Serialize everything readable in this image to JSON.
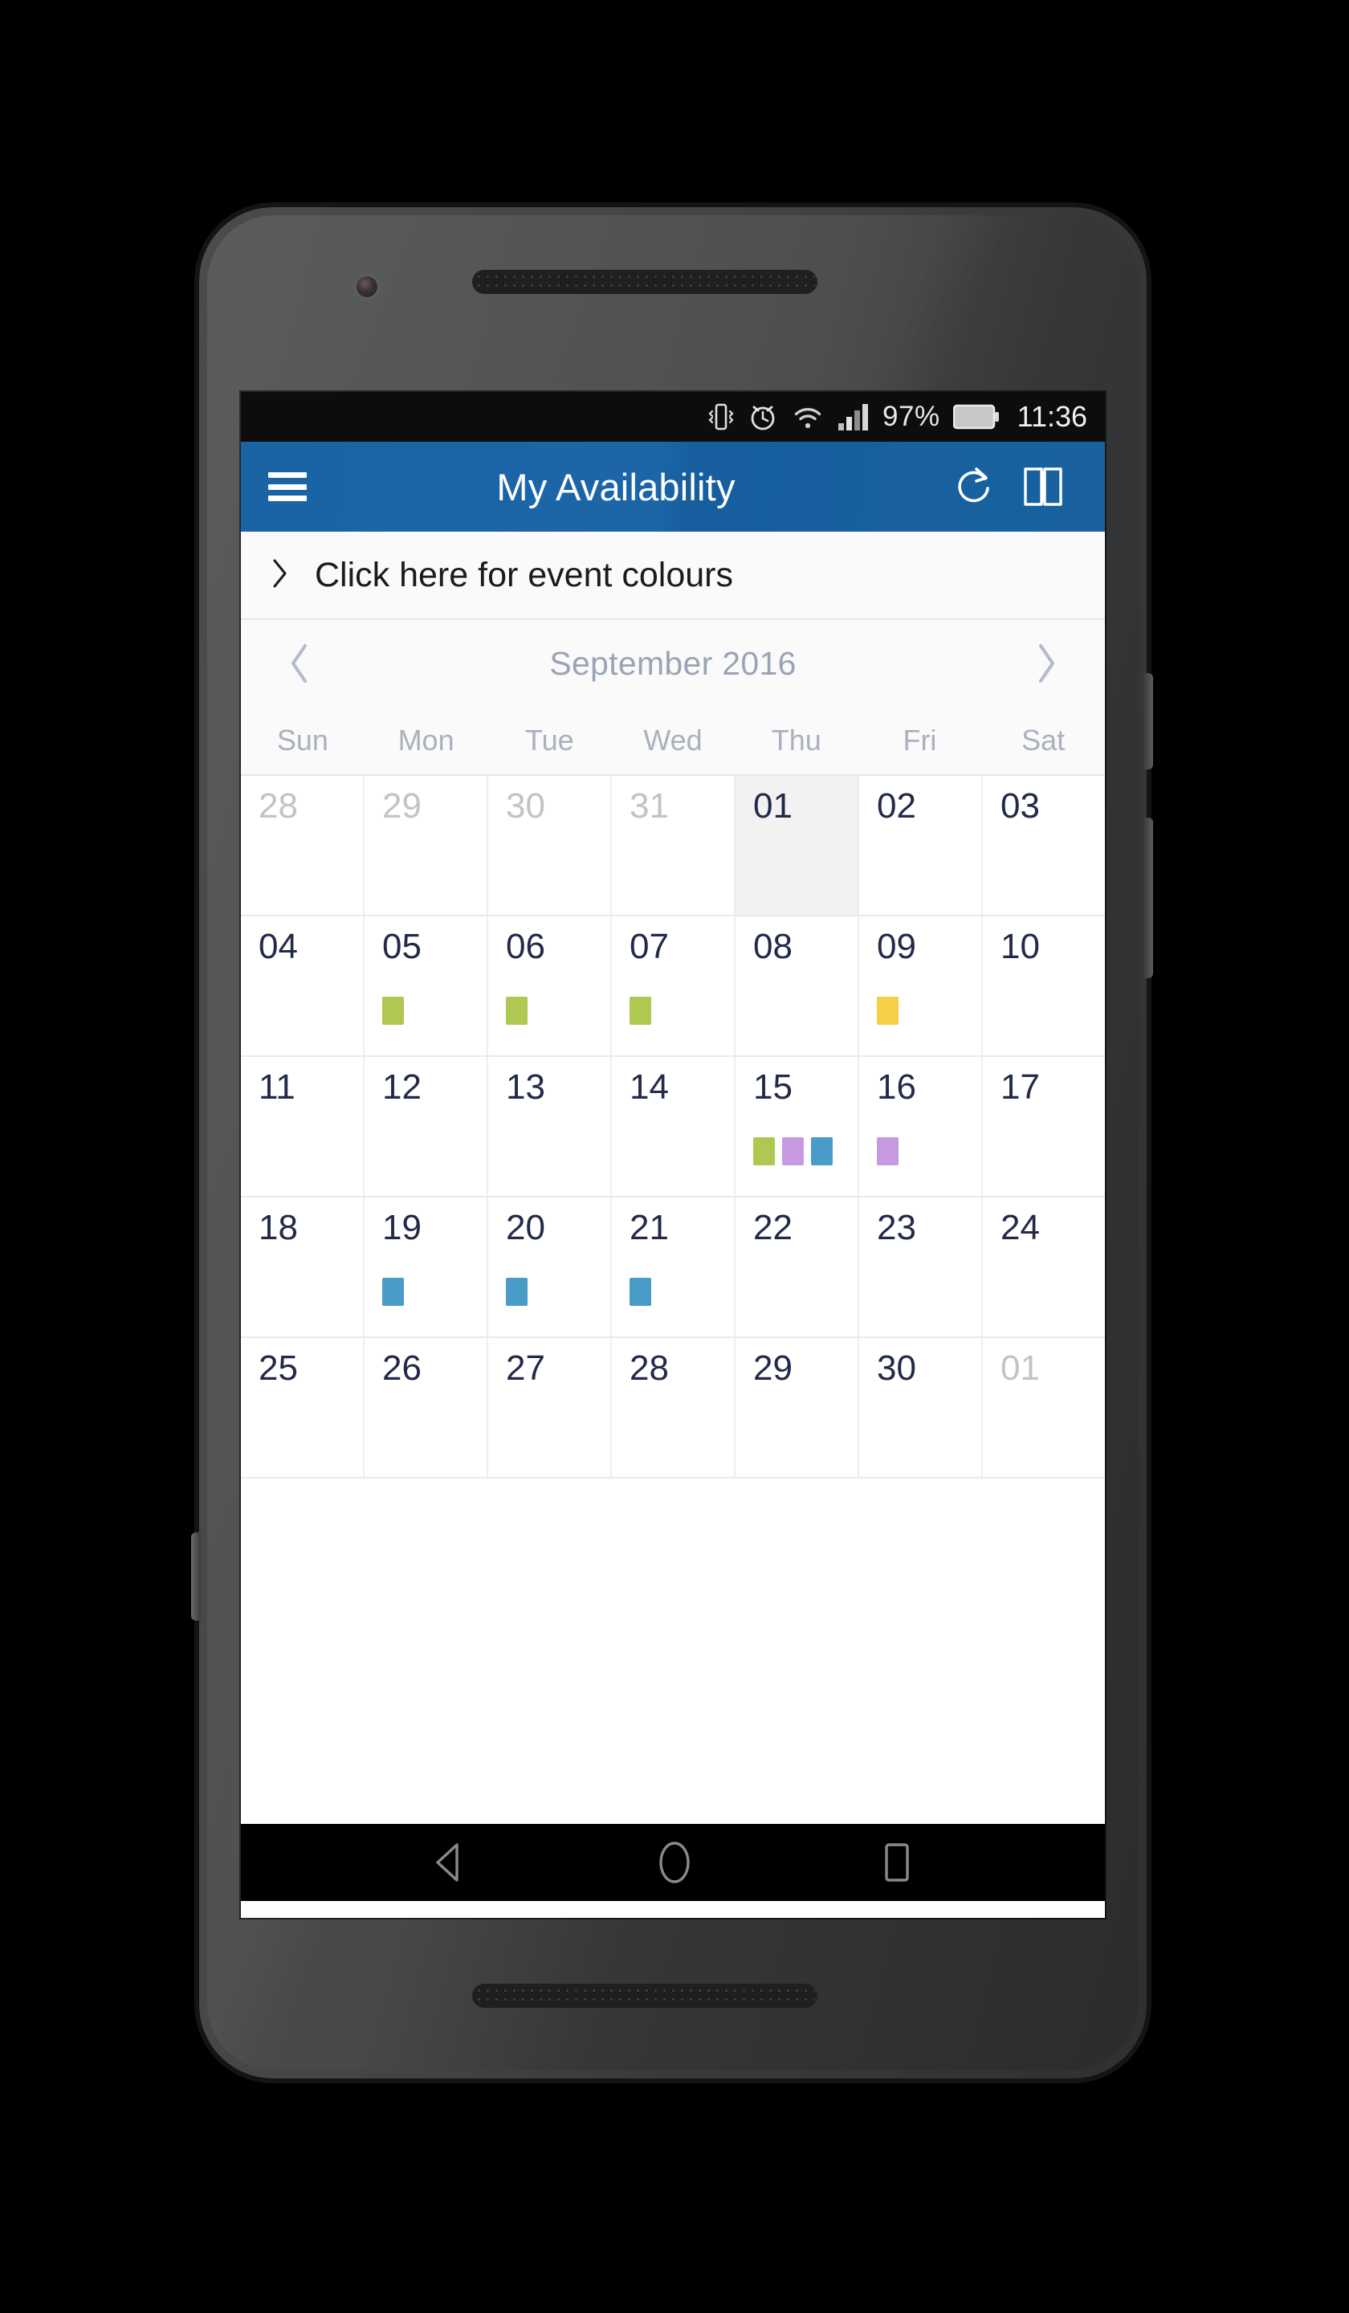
{
  "statusbar": {
    "icons": [
      "vibrate-icon",
      "alarm-icon",
      "wifi-icon",
      "signal-icon",
      "battery-icon"
    ],
    "battery_percent": "97%",
    "time": "11:36"
  },
  "appbar": {
    "menu_icon": "hamburger-menu-icon",
    "title": "My Availability",
    "refresh_icon": "refresh-icon",
    "book_icon": "book-icon",
    "background_color": "#1c66a8"
  },
  "event_colours_bar": {
    "chevron_icon": "chevron-right-icon",
    "label": "Click here for event colours"
  },
  "month_nav": {
    "prev_icon": "chevron-left-icon",
    "label": "September 2016",
    "next_icon": "chevron-right-icon"
  },
  "weekdays": [
    "Sun",
    "Mon",
    "Tue",
    "Wed",
    "Thu",
    "Fri",
    "Sat"
  ],
  "event_colors": {
    "green": "#aec851",
    "yellow": "#f5cf47",
    "purple": "#c79ae0",
    "blue": "#4a9cc8"
  },
  "calendar": {
    "rows": [
      [
        {
          "day": "28",
          "muted": true,
          "today": false,
          "dots": []
        },
        {
          "day": "29",
          "muted": true,
          "today": false,
          "dots": []
        },
        {
          "day": "30",
          "muted": true,
          "today": false,
          "dots": []
        },
        {
          "day": "31",
          "muted": true,
          "today": false,
          "dots": []
        },
        {
          "day": "01",
          "muted": false,
          "today": true,
          "dots": []
        },
        {
          "day": "02",
          "muted": false,
          "today": false,
          "dots": []
        },
        {
          "day": "03",
          "muted": false,
          "today": false,
          "dots": []
        }
      ],
      [
        {
          "day": "04",
          "muted": false,
          "today": false,
          "dots": []
        },
        {
          "day": "05",
          "muted": false,
          "today": false,
          "dots": [
            "green"
          ]
        },
        {
          "day": "06",
          "muted": false,
          "today": false,
          "dots": [
            "green"
          ]
        },
        {
          "day": "07",
          "muted": false,
          "today": false,
          "dots": [
            "green"
          ]
        },
        {
          "day": "08",
          "muted": false,
          "today": false,
          "dots": []
        },
        {
          "day": "09",
          "muted": false,
          "today": false,
          "dots": [
            "yellow"
          ]
        },
        {
          "day": "10",
          "muted": false,
          "today": false,
          "dots": []
        }
      ],
      [
        {
          "day": "11",
          "muted": false,
          "today": false,
          "dots": []
        },
        {
          "day": "12",
          "muted": false,
          "today": false,
          "dots": []
        },
        {
          "day": "13",
          "muted": false,
          "today": false,
          "dots": []
        },
        {
          "day": "14",
          "muted": false,
          "today": false,
          "dots": []
        },
        {
          "day": "15",
          "muted": false,
          "today": false,
          "dots": [
            "green",
            "purple",
            "blue"
          ]
        },
        {
          "day": "16",
          "muted": false,
          "today": false,
          "dots": [
            "purple"
          ]
        },
        {
          "day": "17",
          "muted": false,
          "today": false,
          "dots": []
        }
      ],
      [
        {
          "day": "18",
          "muted": false,
          "today": false,
          "dots": []
        },
        {
          "day": "19",
          "muted": false,
          "today": false,
          "dots": [
            "blue"
          ]
        },
        {
          "day": "20",
          "muted": false,
          "today": false,
          "dots": [
            "blue"
          ]
        },
        {
          "day": "21",
          "muted": false,
          "today": false,
          "dots": [
            "blue"
          ]
        },
        {
          "day": "22",
          "muted": false,
          "today": false,
          "dots": []
        },
        {
          "day": "23",
          "muted": false,
          "today": false,
          "dots": []
        },
        {
          "day": "24",
          "muted": false,
          "today": false,
          "dots": []
        }
      ],
      [
        {
          "day": "25",
          "muted": false,
          "today": false,
          "dots": []
        },
        {
          "day": "26",
          "muted": false,
          "today": false,
          "dots": []
        },
        {
          "day": "27",
          "muted": false,
          "today": false,
          "dots": []
        },
        {
          "day": "28",
          "muted": false,
          "today": false,
          "dots": []
        },
        {
          "day": "29",
          "muted": false,
          "today": false,
          "dots": []
        },
        {
          "day": "30",
          "muted": false,
          "today": false,
          "dots": []
        },
        {
          "day": "01",
          "muted": true,
          "today": false,
          "dots": []
        }
      ]
    ]
  },
  "navbar": {
    "back_icon": "back-triangle-icon",
    "home_icon": "home-circle-icon",
    "recents_icon": "recents-square-icon"
  }
}
